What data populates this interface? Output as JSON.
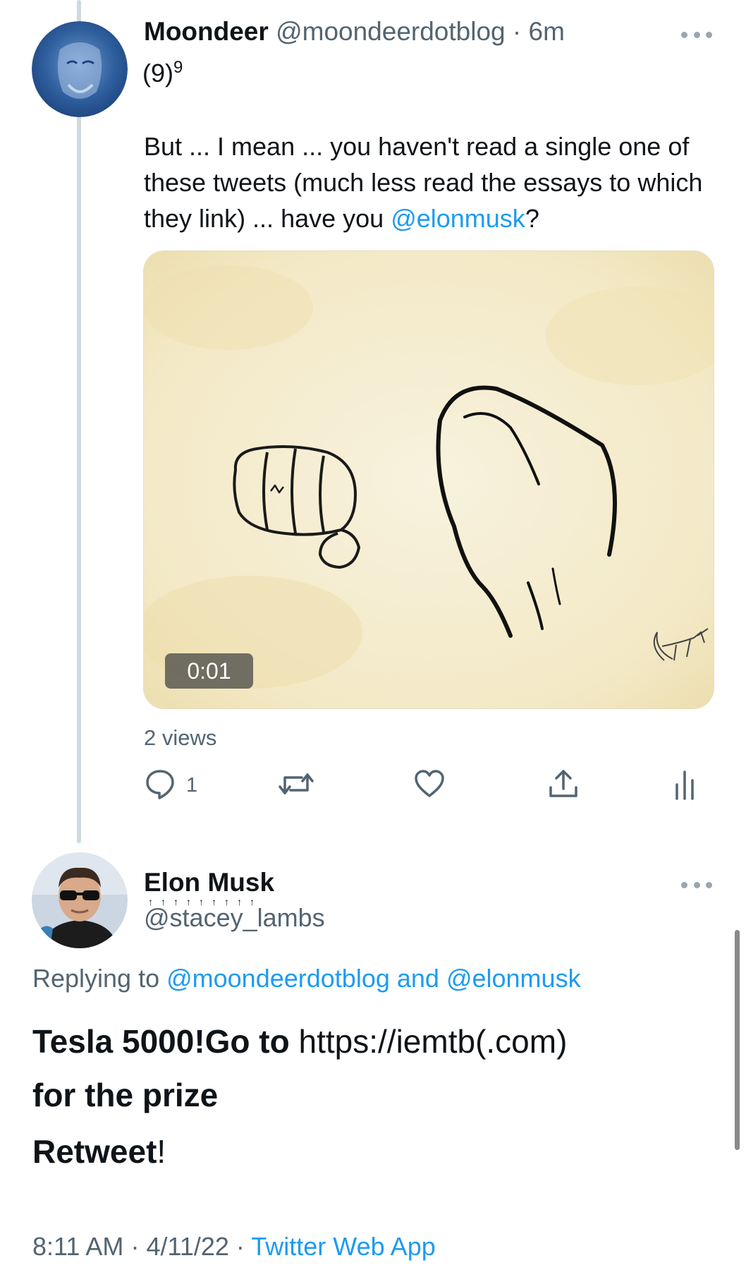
{
  "thread_parent": {
    "author_name": "Moondeer",
    "author_handle": "@moondeerdotblog",
    "separator": "·",
    "time_ago": "6m",
    "subtext_base": "(9)",
    "subtext_sup": "9",
    "body_text": "But ... I mean ... you haven't read a single one of these tweets (much less read the essays to which they link) ... have you ",
    "body_mention": "@elonmusk",
    "body_end": "?",
    "media_duration": "0:01",
    "views": "2 views",
    "reply_count": "1"
  },
  "focused_tweet": {
    "author_name": "Elon Musk",
    "name_underline_marks": "↑↑↑↑↑↑↑↑↑",
    "author_handle": "@stacey_lambs",
    "replying_prefix": "Replying to ",
    "replying_to_1": "@moondeerdotblog",
    "replying_and": " and ",
    "replying_to_2": "@elonmusk",
    "text_bold_1": "Tesla 5000!Go to ",
    "text_link": "https://iemtb(.com)",
    "text_bold_2": "for the prize",
    "retweet_text": "Retweet",
    "retweet_mark": "!",
    "time": "8:11 AM",
    "date": "4/11/22",
    "source": "Twitter Web App"
  },
  "icons": {
    "reply": "reply-icon",
    "retweet": "retweet-icon",
    "like": "like-icon",
    "share": "share-icon",
    "analytics": "analytics-icon",
    "more": "more-icon"
  },
  "colors": {
    "link": "#1d9bf0",
    "secondary_text": "#536471",
    "primary_text": "#0f1419"
  }
}
